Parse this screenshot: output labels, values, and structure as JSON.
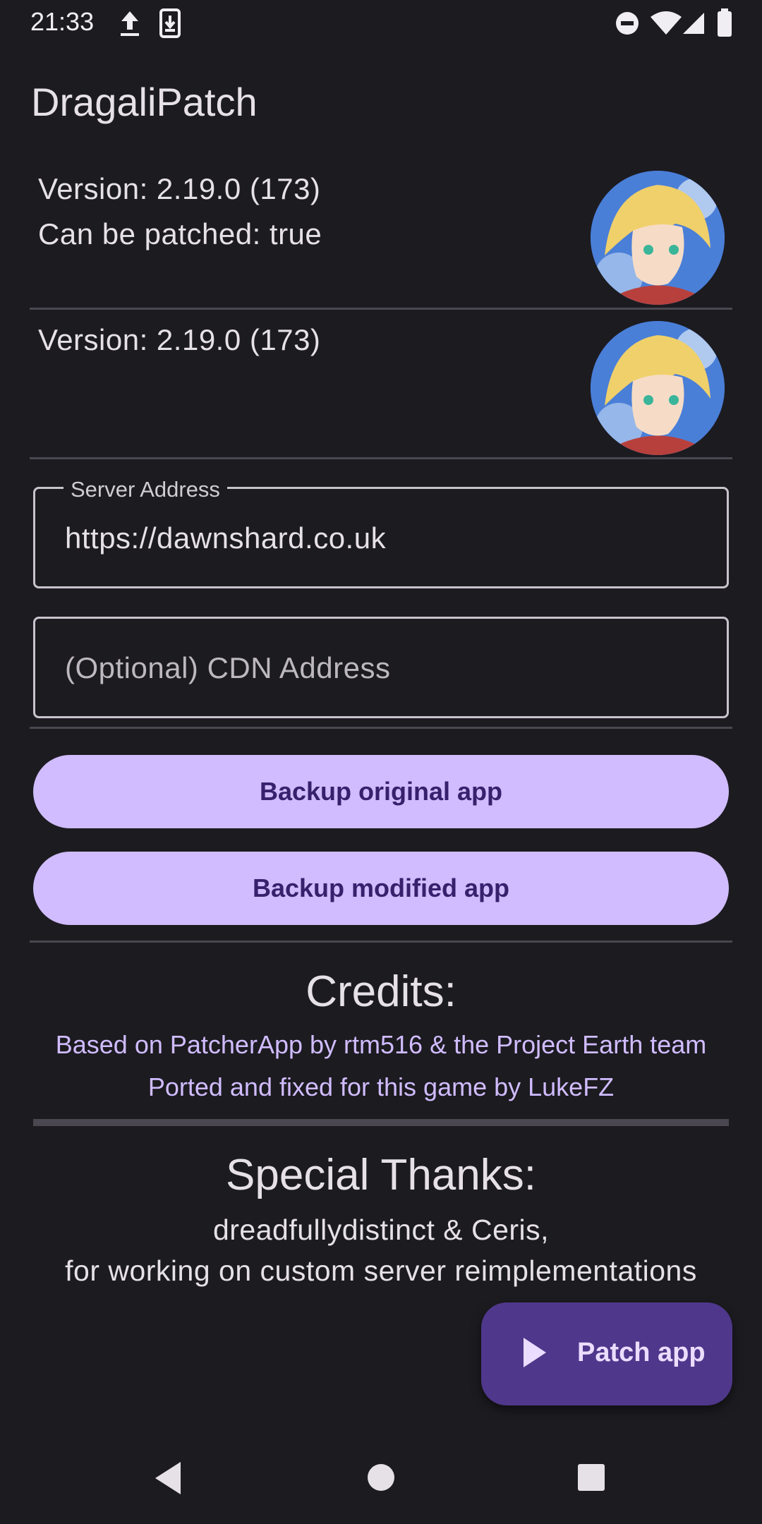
{
  "status_bar": {
    "time": "21:33",
    "icons": [
      "upload-icon",
      "download-icon",
      "do-not-disturb-icon",
      "wifi-icon",
      "cell-signal-icon",
      "battery-icon"
    ]
  },
  "app": {
    "title": "DragaliPatch"
  },
  "original_app": {
    "version": "Version: 2.19.0 (173)",
    "patchable": "Can be patched: true"
  },
  "modified_app": {
    "version": "Version: 2.19.0 (173)"
  },
  "server_address": {
    "label": "Server Address",
    "value": "https://dawnshard.co.uk"
  },
  "cdn_address": {
    "placeholder": "(Optional) CDN Address"
  },
  "buttons": {
    "backup_original": "Backup original app",
    "backup_modified": "Backup modified app"
  },
  "credits": {
    "title": "Credits:",
    "lines": [
      "Based on PatcherApp by rtm516 & the Project Earth team",
      "Ported and fixed for this game by LukeFZ"
    ]
  },
  "special_thanks": {
    "title": "Special Thanks:",
    "lines": [
      "dreadfullydistinct & Ceris,",
      "for working on custom server reimplementations"
    ]
  },
  "fab": {
    "label": "Patch app",
    "icon": "play-icon"
  },
  "nav": {
    "icons": [
      "back-icon",
      "home-icon",
      "recents-icon"
    ]
  },
  "colors": {
    "background": "#1c1b20",
    "accent": "#d0bcff",
    "fab": "#4f378b"
  }
}
